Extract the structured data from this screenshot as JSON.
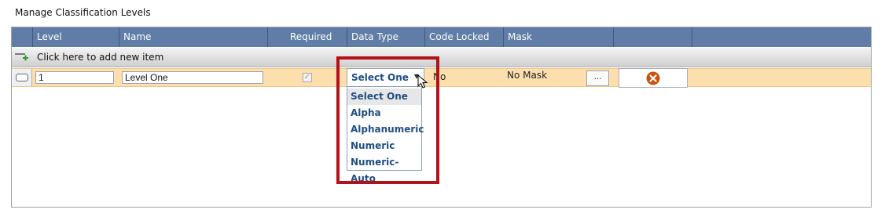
{
  "page_title": "Manage Classification Levels",
  "columns": [
    "Level",
    "Name",
    "Required",
    "Data Type",
    "Code Locked",
    "Mask"
  ],
  "add_row_label": "Click here to add new item",
  "row": {
    "level": "1",
    "name": "Level One",
    "required_checked": true,
    "data_type": "Select One",
    "code_locked": "No",
    "mask": "No Mask",
    "mask_button": "..."
  },
  "dropdown_options": [
    "Select One",
    "Alpha",
    "Alphanumeric",
    "Numeric",
    "Numeric-Auto"
  ],
  "selected_option": "Select One",
  "colors": {
    "header_bg": "#5f7da6",
    "row_highlight": "#fddfae",
    "option_text": "#1f4e84",
    "annotation_box": "#b3121a",
    "delete_icon": "#c8530f"
  },
  "icons": [
    "add-row-icon",
    "row-selector-icon",
    "dropdown-arrow-icon",
    "delete-icon",
    "mouse-cursor-icon"
  ]
}
